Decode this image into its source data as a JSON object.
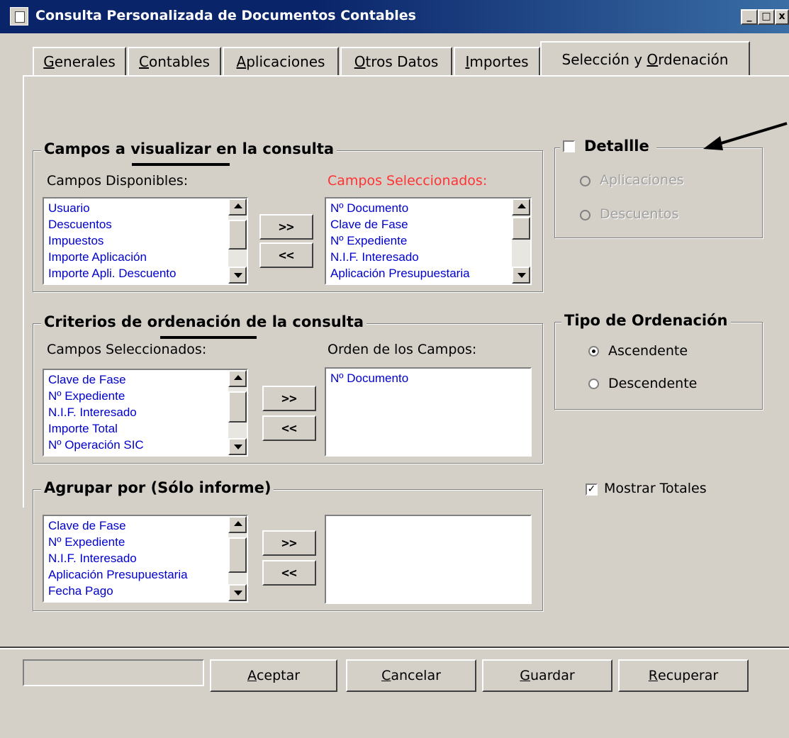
{
  "window": {
    "title": "Consulta Personalizada de Documentos Contables",
    "controls": [
      "_",
      "□",
      "x"
    ]
  },
  "tabs": [
    {
      "label": "Generales",
      "access": "G",
      "rest": "enerales"
    },
    {
      "label": "Contables",
      "access": "C",
      "rest": "ontables"
    },
    {
      "label": "Aplicaciones",
      "access": "A",
      "rest": "plicaciones"
    },
    {
      "label": "Otros Datos",
      "access": "O",
      "rest": "tros Datos"
    },
    {
      "label": "Importes",
      "access": "I",
      "rest": "mportes"
    },
    {
      "label": "Selección y Ordenación",
      "pre": "Selección y ",
      "access": "O",
      "rest": "rdenación",
      "active": true
    }
  ],
  "campos_visualizar": {
    "title": "Campos a visualizar en la consulta",
    "available_label": "Campos Disponibles:",
    "selected_label": "Campos Seleccionados:",
    "available": [
      "Usuario",
      "Descuentos",
      "Impuestos",
      "Importe Aplicación",
      "Importe Apli. Descuento"
    ],
    "selected": [
      "Nº Documento",
      "Clave de Fase",
      "Nº Expediente",
      "N.I.F. Interesado",
      "Aplicación Presupuestaria"
    ],
    "add_label": ">>",
    "remove_label": "<<"
  },
  "criterios_ordenacion": {
    "title": "Criterios de ordenación de la consulta",
    "selected_label": "Campos Seleccionados:",
    "order_label": "Orden de los Campos:",
    "selected": [
      "Clave de Fase",
      "Nº Expediente",
      "N.I.F. Interesado",
      "Importe Total",
      "Nº Operación SIC"
    ],
    "order": [
      "Nº Documento"
    ],
    "add_label": ">>",
    "remove_label": "<<"
  },
  "agrupar": {
    "title": "Agrupar por (Sólo informe)",
    "available": [
      "Clave de Fase",
      "Nº Expediente",
      "N.I.F. Interesado",
      "Aplicación Presupuestaria",
      "Fecha Pago"
    ],
    "grouped": [],
    "add_label": ">>",
    "remove_label": "<<"
  },
  "detalle": {
    "label": "Detallle",
    "checked": false,
    "options": [
      "Aplicaciones",
      "Descuentos"
    ]
  },
  "tipo_ordenacion": {
    "title": "Tipo de Ordenación",
    "options": [
      "Ascendente",
      "Descendente"
    ],
    "selected": "Ascendente"
  },
  "mostrar_totales": {
    "label": "Mostrar Totales",
    "checked": true
  },
  "footer": {
    "status": "",
    "buttons": [
      {
        "label": "Aceptar",
        "access": "A",
        "rest": "ceptar"
      },
      {
        "label": "Cancelar",
        "access": "C",
        "rest": "ancelar"
      },
      {
        "label": "Guardar",
        "access": "G",
        "rest": "uardar"
      },
      {
        "label": "Recuperar",
        "access": "R",
        "rest": "ecuperar"
      }
    ]
  },
  "colors": {
    "titlebar": "#0a246a",
    "face": "#d4d0c8",
    "list_text": "#0000cc",
    "highlight_label": "#ff3333"
  }
}
